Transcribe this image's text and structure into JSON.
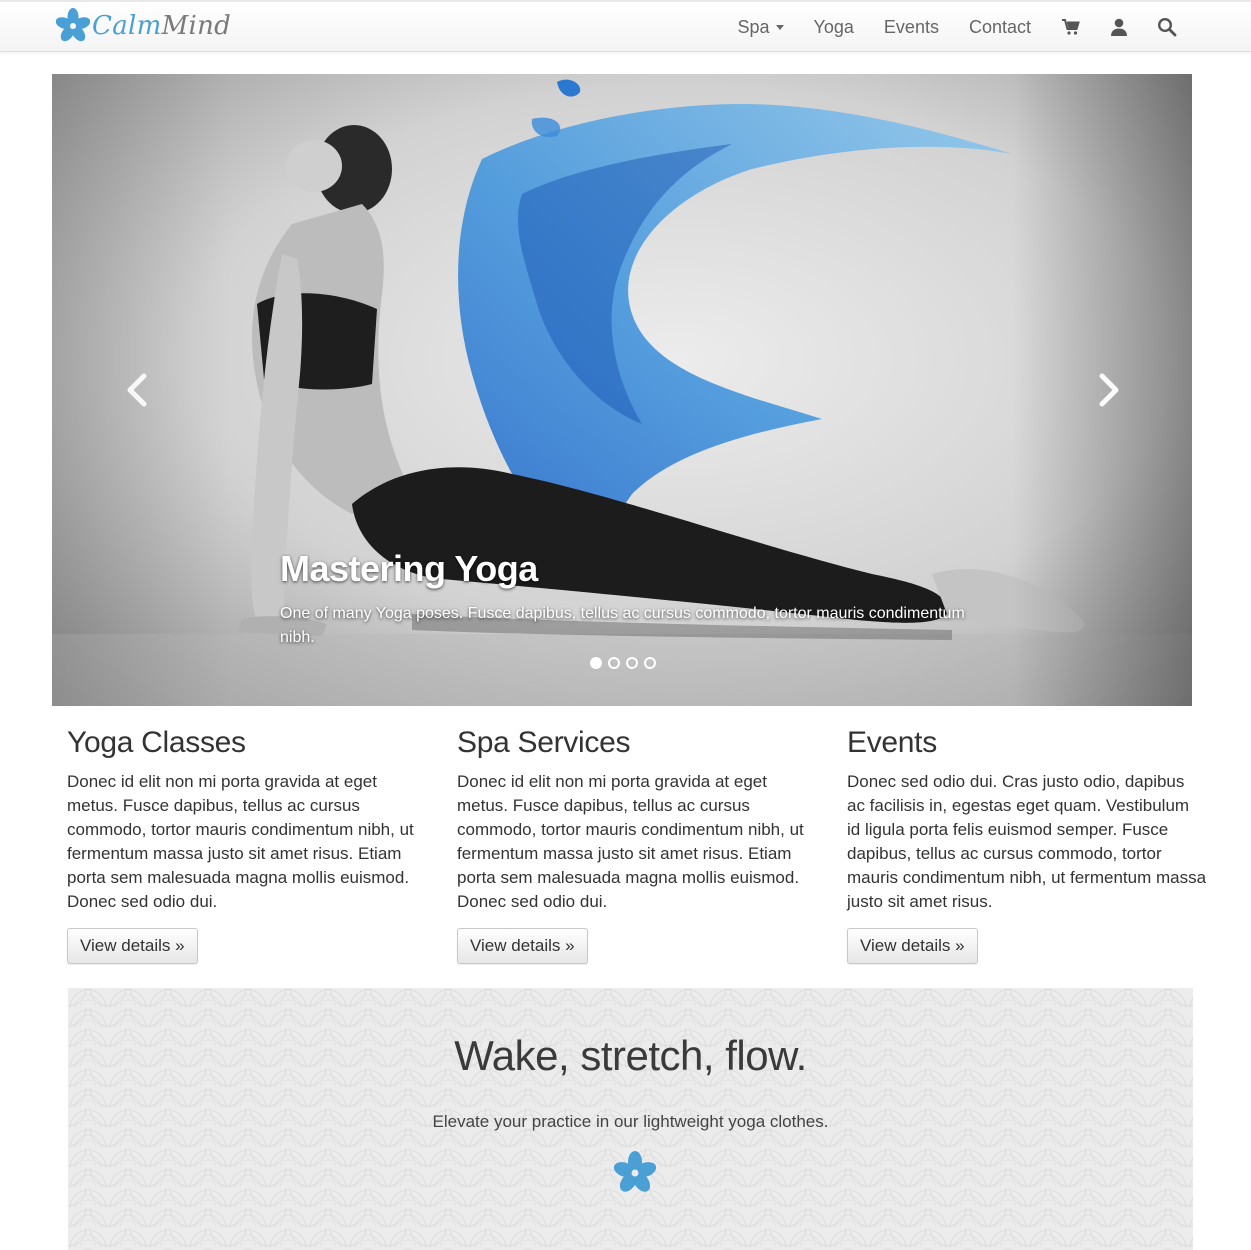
{
  "brand": {
    "name_part1": "Calm",
    "name_part2": "Mind",
    "icon": "flower-logo-icon",
    "accent_color": "#4a9fd5"
  },
  "nav": {
    "items": [
      {
        "label": "Spa",
        "has_dropdown": true
      },
      {
        "label": "Yoga"
      },
      {
        "label": "Events"
      },
      {
        "label": "Contact"
      }
    ],
    "icons": [
      "cart-icon",
      "user-icon",
      "search-icon"
    ]
  },
  "carousel": {
    "title": "Mastering Yoga",
    "text": "One of many Yoga poses. Fusce dapibus, tellus ac cursus commodo, tortor mauris condimentum nibh.",
    "slide_count": 4,
    "active_slide": 1
  },
  "features": [
    {
      "title": "Yoga Classes",
      "text": "Donec id elit non mi porta gravida at eget metus. Fusce dapibus, tellus ac cursus commodo, tortor mauris condimentum nibh, ut fermentum massa justo sit amet risus. Etiam porta sem malesuada magna mollis euismod. Donec sed odio dui.",
      "button": "View details »"
    },
    {
      "title": "Spa Services",
      "text": "Donec id elit non mi porta gravida at eget metus. Fusce dapibus, tellus ac cursus commodo, tortor mauris condimentum nibh, ut fermentum massa justo sit amet risus. Etiam porta sem malesuada magna mollis euismod. Donec sed odio dui.",
      "button": "View details »"
    },
    {
      "title": "Events",
      "text": "Donec sed odio dui. Cras justo odio, dapibus ac facilisis in, egestas eget quam. Vestibulum id ligula porta felis euismod semper. Fusce dapibus, tellus ac cursus commodo, tortor mauris condimentum nibh, ut fermentum massa justo sit amet risus.",
      "button": "View details »"
    }
  ],
  "promo": {
    "heading": "Wake, stretch, flow.",
    "subtext": "Elevate your practice in our lightweight yoga clothes."
  }
}
